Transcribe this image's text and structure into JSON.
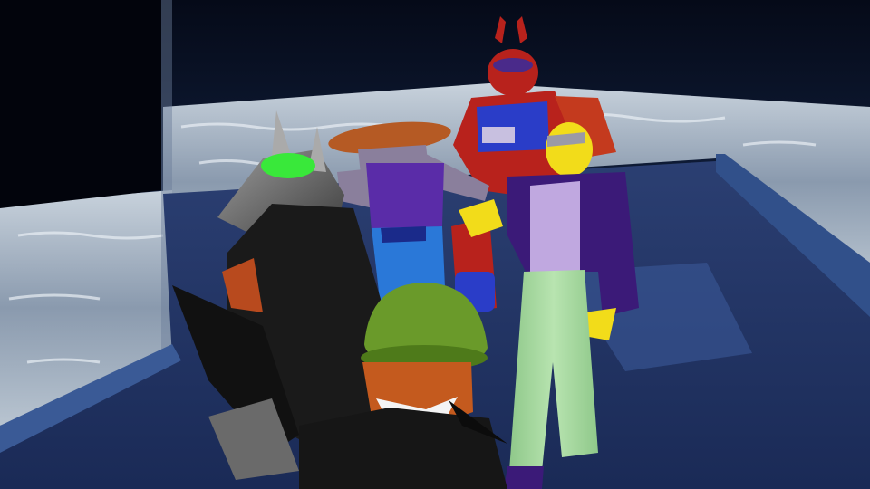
{
  "scene": {
    "type": "3D game scene",
    "colors": {
      "sky_top": "#0a1530",
      "sky_horizon": "#2a4a7a",
      "water_light": "#c8d2dc",
      "water_mid": "#8a9aae",
      "dock": "#233a6e",
      "dock_rail": "#31508a",
      "character_red": "#b8221c",
      "character_blue": "#2a3dc8",
      "character_purple": "#3b1a78",
      "character_yellow": "#f2dc1a",
      "pants_green": "#a6d8a0",
      "helmet_green": "#6a9a2a",
      "visor_green": "#39e83a",
      "hair_orange": "#c45a1e"
    },
    "icons": [
      "red-robot-character",
      "purple-vest-character",
      "yellow-jacket-character",
      "gray-hooded-character",
      "green-helmet-character"
    ]
  }
}
